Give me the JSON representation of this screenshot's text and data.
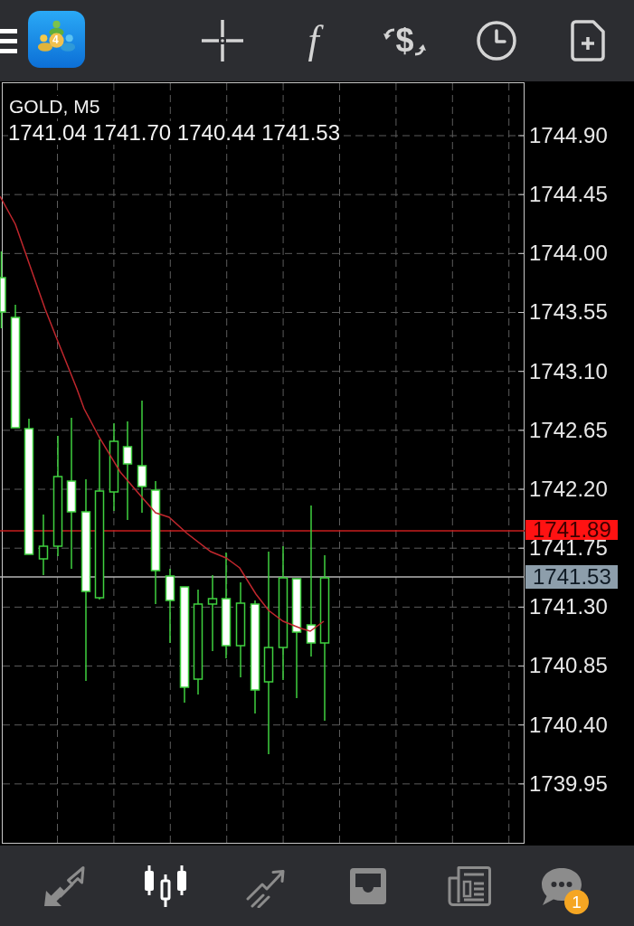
{
  "top_bar": {
    "logo_digit": "4",
    "toolbar": [
      {
        "kind": "crosshair"
      },
      {
        "kind": "indicators",
        "glyph": "f"
      },
      {
        "kind": "symbol",
        "glyph": "$"
      },
      {
        "kind": "timeframe"
      },
      {
        "kind": "new-order"
      }
    ]
  },
  "chart": {
    "title": "GOLD, M5",
    "ohlc": "1741.04 1741.70 1740.44 1741.53",
    "price_axis": [
      "1744.90",
      "1744.45",
      "1744.00",
      "1743.55",
      "1743.10",
      "1742.65",
      "1742.20",
      "1741.75",
      "1741.30",
      "1740.85",
      "1740.40",
      "1739.95"
    ],
    "ask_tag": "1741.89",
    "bid_tag": "1741.53"
  },
  "bottom_nav": [
    {
      "kind": "quotes",
      "selected": false
    },
    {
      "kind": "chart",
      "selected": true
    },
    {
      "kind": "trade",
      "selected": false
    },
    {
      "kind": "history",
      "selected": false
    },
    {
      "kind": "news",
      "selected": false
    },
    {
      "kind": "messages",
      "selected": false,
      "badge": "1"
    }
  ]
}
